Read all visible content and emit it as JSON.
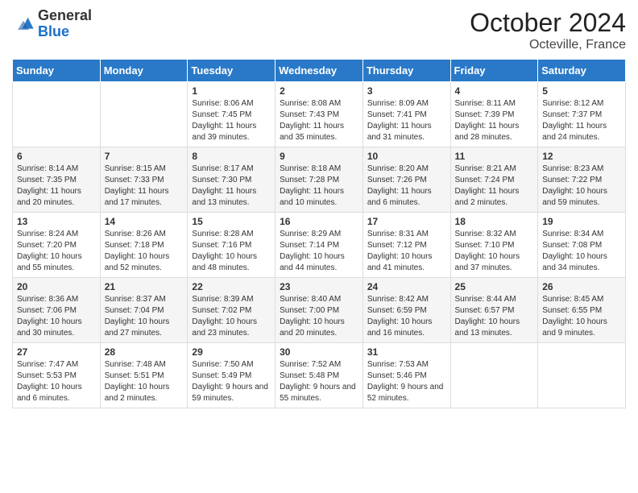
{
  "header": {
    "logo_general": "General",
    "logo_blue": "Blue",
    "month_year": "October 2024",
    "location": "Octeville, France"
  },
  "days_of_week": [
    "Sunday",
    "Monday",
    "Tuesday",
    "Wednesday",
    "Thursday",
    "Friday",
    "Saturday"
  ],
  "weeks": [
    [
      {
        "num": "",
        "detail": ""
      },
      {
        "num": "",
        "detail": ""
      },
      {
        "num": "1",
        "detail": "Sunrise: 8:06 AM\nSunset: 7:45 PM\nDaylight: 11 hours and 39 minutes."
      },
      {
        "num": "2",
        "detail": "Sunrise: 8:08 AM\nSunset: 7:43 PM\nDaylight: 11 hours and 35 minutes."
      },
      {
        "num": "3",
        "detail": "Sunrise: 8:09 AM\nSunset: 7:41 PM\nDaylight: 11 hours and 31 minutes."
      },
      {
        "num": "4",
        "detail": "Sunrise: 8:11 AM\nSunset: 7:39 PM\nDaylight: 11 hours and 28 minutes."
      },
      {
        "num": "5",
        "detail": "Sunrise: 8:12 AM\nSunset: 7:37 PM\nDaylight: 11 hours and 24 minutes."
      }
    ],
    [
      {
        "num": "6",
        "detail": "Sunrise: 8:14 AM\nSunset: 7:35 PM\nDaylight: 11 hours and 20 minutes."
      },
      {
        "num": "7",
        "detail": "Sunrise: 8:15 AM\nSunset: 7:33 PM\nDaylight: 11 hours and 17 minutes."
      },
      {
        "num": "8",
        "detail": "Sunrise: 8:17 AM\nSunset: 7:30 PM\nDaylight: 11 hours and 13 minutes."
      },
      {
        "num": "9",
        "detail": "Sunrise: 8:18 AM\nSunset: 7:28 PM\nDaylight: 11 hours and 10 minutes."
      },
      {
        "num": "10",
        "detail": "Sunrise: 8:20 AM\nSunset: 7:26 PM\nDaylight: 11 hours and 6 minutes."
      },
      {
        "num": "11",
        "detail": "Sunrise: 8:21 AM\nSunset: 7:24 PM\nDaylight: 11 hours and 2 minutes."
      },
      {
        "num": "12",
        "detail": "Sunrise: 8:23 AM\nSunset: 7:22 PM\nDaylight: 10 hours and 59 minutes."
      }
    ],
    [
      {
        "num": "13",
        "detail": "Sunrise: 8:24 AM\nSunset: 7:20 PM\nDaylight: 10 hours and 55 minutes."
      },
      {
        "num": "14",
        "detail": "Sunrise: 8:26 AM\nSunset: 7:18 PM\nDaylight: 10 hours and 52 minutes."
      },
      {
        "num": "15",
        "detail": "Sunrise: 8:28 AM\nSunset: 7:16 PM\nDaylight: 10 hours and 48 minutes."
      },
      {
        "num": "16",
        "detail": "Sunrise: 8:29 AM\nSunset: 7:14 PM\nDaylight: 10 hours and 44 minutes."
      },
      {
        "num": "17",
        "detail": "Sunrise: 8:31 AM\nSunset: 7:12 PM\nDaylight: 10 hours and 41 minutes."
      },
      {
        "num": "18",
        "detail": "Sunrise: 8:32 AM\nSunset: 7:10 PM\nDaylight: 10 hours and 37 minutes."
      },
      {
        "num": "19",
        "detail": "Sunrise: 8:34 AM\nSunset: 7:08 PM\nDaylight: 10 hours and 34 minutes."
      }
    ],
    [
      {
        "num": "20",
        "detail": "Sunrise: 8:36 AM\nSunset: 7:06 PM\nDaylight: 10 hours and 30 minutes."
      },
      {
        "num": "21",
        "detail": "Sunrise: 8:37 AM\nSunset: 7:04 PM\nDaylight: 10 hours and 27 minutes."
      },
      {
        "num": "22",
        "detail": "Sunrise: 8:39 AM\nSunset: 7:02 PM\nDaylight: 10 hours and 23 minutes."
      },
      {
        "num": "23",
        "detail": "Sunrise: 8:40 AM\nSunset: 7:00 PM\nDaylight: 10 hours and 20 minutes."
      },
      {
        "num": "24",
        "detail": "Sunrise: 8:42 AM\nSunset: 6:59 PM\nDaylight: 10 hours and 16 minutes."
      },
      {
        "num": "25",
        "detail": "Sunrise: 8:44 AM\nSunset: 6:57 PM\nDaylight: 10 hours and 13 minutes."
      },
      {
        "num": "26",
        "detail": "Sunrise: 8:45 AM\nSunset: 6:55 PM\nDaylight: 10 hours and 9 minutes."
      }
    ],
    [
      {
        "num": "27",
        "detail": "Sunrise: 7:47 AM\nSunset: 5:53 PM\nDaylight: 10 hours and 6 minutes."
      },
      {
        "num": "28",
        "detail": "Sunrise: 7:48 AM\nSunset: 5:51 PM\nDaylight: 10 hours and 2 minutes."
      },
      {
        "num": "29",
        "detail": "Sunrise: 7:50 AM\nSunset: 5:49 PM\nDaylight: 9 hours and 59 minutes."
      },
      {
        "num": "30",
        "detail": "Sunrise: 7:52 AM\nSunset: 5:48 PM\nDaylight: 9 hours and 55 minutes."
      },
      {
        "num": "31",
        "detail": "Sunrise: 7:53 AM\nSunset: 5:46 PM\nDaylight: 9 hours and 52 minutes."
      },
      {
        "num": "",
        "detail": ""
      },
      {
        "num": "",
        "detail": ""
      }
    ]
  ]
}
